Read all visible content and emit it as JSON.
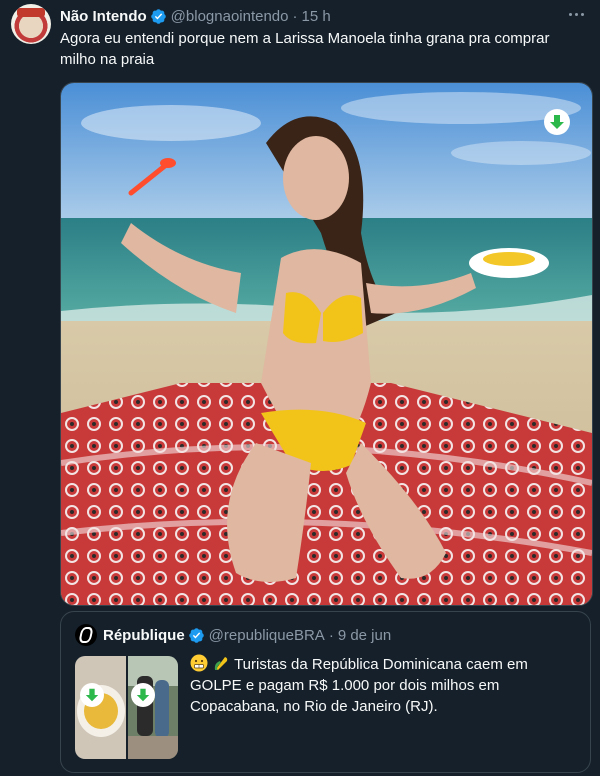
{
  "tweet": {
    "author_name": "Não Intendo",
    "handle": "@blognaointendo",
    "separator": "·",
    "time": "15 h",
    "text": "Agora eu entendi porque nem a Larissa Manoela tinha grana pra comprar milho na praia"
  },
  "icons": {
    "verified": "verified-badge-icon",
    "more": "more-options-icon",
    "download": "download-arrow-icon"
  },
  "colors": {
    "background": "#15202b",
    "verified": "#1d9bf0",
    "secondary_text": "#8b98a5",
    "border": "#38444d",
    "download_green": "#2db84c"
  },
  "quote": {
    "author_name": "République",
    "handle": "@republiqueBRA",
    "separator": "·",
    "date": "9 de jun",
    "text": "Turistas da República Dominicana caem em GOLPE e pagam R$ 1.000 por dois milhos em Copacabana, no Rio de Janeiro (RJ).",
    "emojis": [
      "grimacing-face-emoji",
      "corn-emoji"
    ]
  }
}
